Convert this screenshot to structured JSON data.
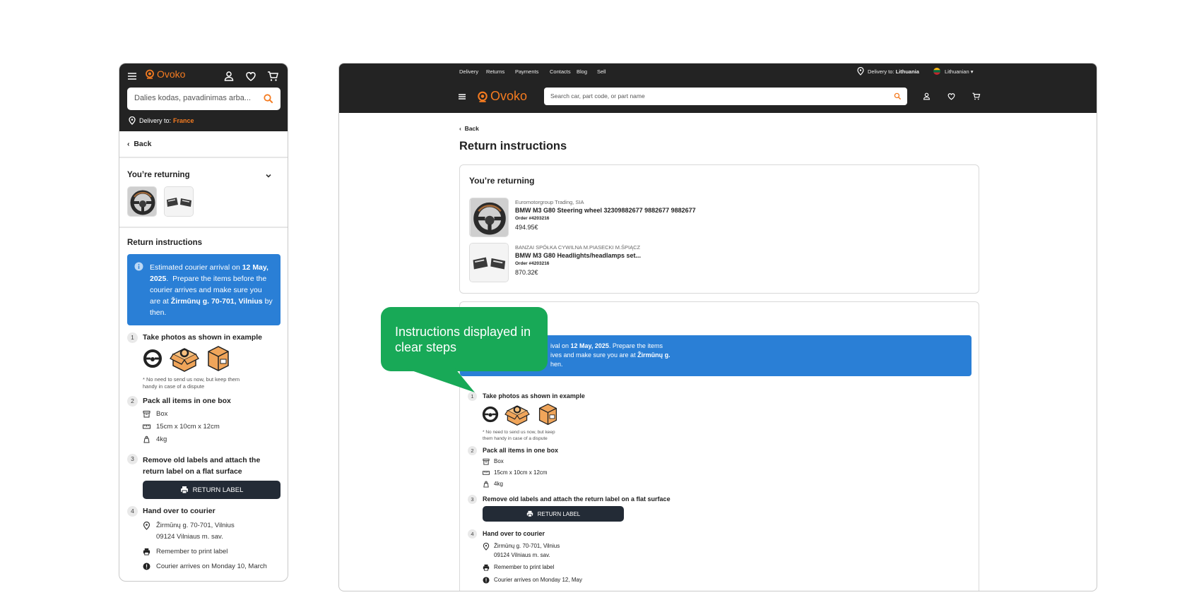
{
  "brand": {
    "name": "Ovoko",
    "accent": "#f47b20",
    "header_bg": "#232323",
    "info_blue": "#2a7fd6",
    "callout_green": "#18a957"
  },
  "mobile": {
    "search_placeholder": "Dalies kodas, pavadinimas arba...",
    "delivery_label": "Delivery to:",
    "delivery_country": "France",
    "back": "Back",
    "returning_title": "You’re returning",
    "section_title": "Return instructions",
    "info_text": "Estimated courier arrival on 12 May, 2025. Prepare the items before the courier arrives and make sure you are at Žirmūnų g. 70-701, Vilnius by then.",
    "info_date": "12 May, 2025",
    "info_address": "Žirmūnų g. 70-701, Vilnius",
    "steps": [
      {
        "num": "1",
        "title": "Take photos as shown in example"
      },
      {
        "num": "2",
        "title": "Pack all items in one box"
      },
      {
        "num": "3",
        "title": "Remove old labels and attach the return label on a flat surface"
      },
      {
        "num": "4",
        "title": "Hand over to courier"
      }
    ],
    "photo_note": "* No need to send us now, but keep them handy in case of a dispute",
    "pack": {
      "box": "Box",
      "dims": "15cm x 10cm x 12cm",
      "weight": "4kg"
    },
    "return_label_btn": "RETURN LABEL",
    "courier": {
      "address1": "Žirmūnų g. 70-701, Vilnius",
      "address2": "09124 Vilniaus m. sav.",
      "print": "Remember to print label",
      "arrival": "Courier arrives on Monday 10, March"
    }
  },
  "desktop": {
    "top_links": [
      "Delivery",
      "Returns",
      "Payments",
      "Contacts",
      "Blog",
      "Sell"
    ],
    "delivery_label": "Delivery to:",
    "delivery_country": "Lithuania",
    "language": "Lithuanian",
    "search_placeholder": "Search car,  part code, or part name",
    "back": "Back",
    "page_title": "Return instructions",
    "returning_title": "You’re returning",
    "items": [
      {
        "seller": "Euromotorgroup Trading, SIA",
        "name": "BMW M3 G80 Steering wheel 32309882677 9882677 9882677",
        "order": "Order #4203216",
        "price": "494.95€"
      },
      {
        "seller": "BANZAI SPÓŁKA CYWILNA M.PIASECKI M.ŚPIĄCZ",
        "name": "BMW M3 G80 Headlights/headlamps set...",
        "order": "Order #4203216",
        "price": "870.32€"
      }
    ],
    "info_line1": "ival on 12 May, 2025.  Prepare the items",
    "info_line2": "ives and make sure you are at Žirmūnų g.",
    "info_line3": "hen.",
    "steps": [
      {
        "num": "1",
        "title": "Take photos as shown in example"
      },
      {
        "num": "2",
        "title": "Pack all items in one box"
      },
      {
        "num": "3",
        "title": "Remove old labels and attach the return label on a flat surface"
      },
      {
        "num": "4",
        "title": "Hand over to courier"
      }
    ],
    "photo_note": "* No need to send us now, but keep them handy in case of a dispute",
    "pack": {
      "box": "Box",
      "dims": "15cm x 10cm x 12cm",
      "weight": "4kg"
    },
    "return_label_btn": "RETURN LABEL",
    "courier": {
      "address1": "Žirmūnų g. 70-701, Vilnius",
      "address2": "09124 Vilniaus m. sav.",
      "print": "Remember to print label",
      "arrival": "Courier arrives on Monday 12, May"
    }
  },
  "callout": {
    "text": "Instructions displayed in clear steps"
  }
}
